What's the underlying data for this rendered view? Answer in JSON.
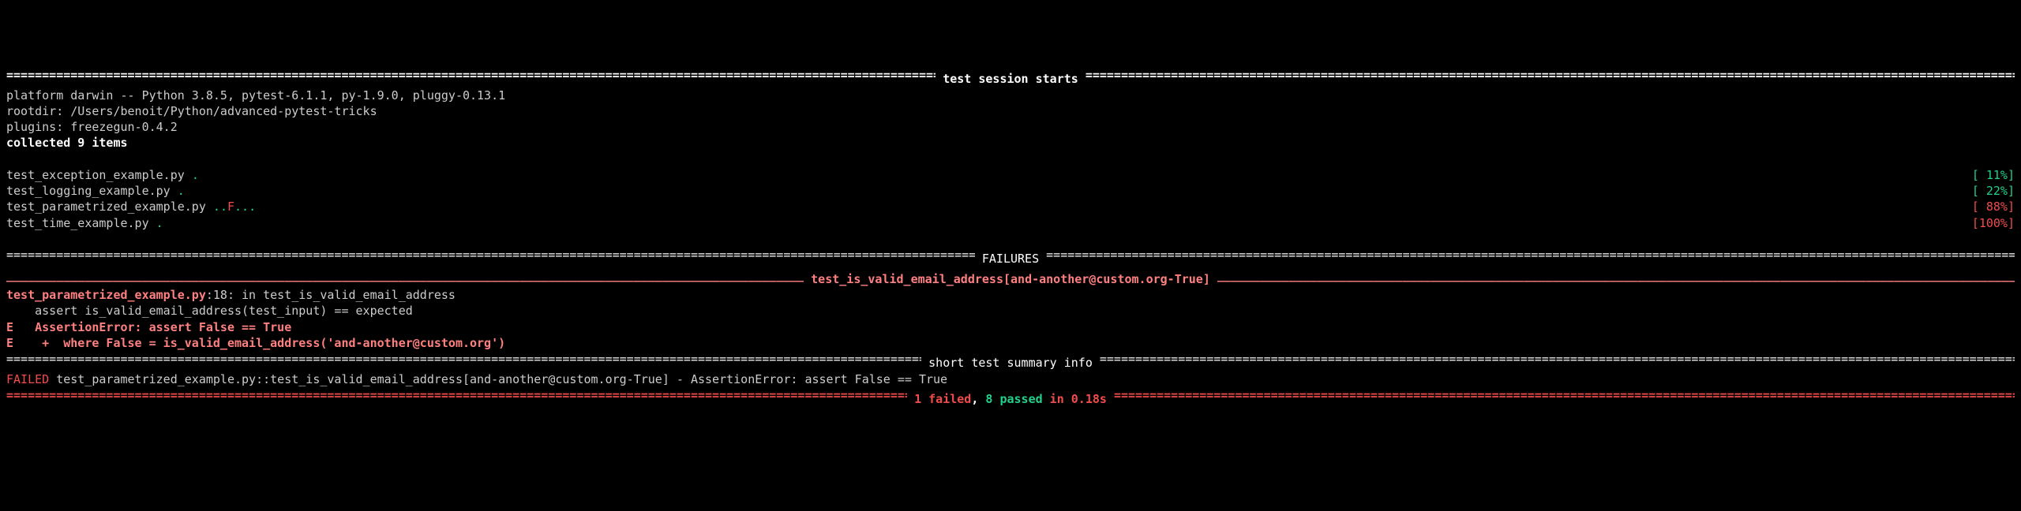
{
  "session": {
    "header_label": "test session starts",
    "platform_line": "platform darwin -- Python 3.8.5, pytest-6.1.1, py-1.9.0, pluggy-0.13.1",
    "rootdir_line": "rootdir: /Users/benoit/Python/advanced-pytest-tricks",
    "plugins_line": "plugins: freezegun-0.4.2",
    "collected_line": "collected 9 items"
  },
  "files": [
    {
      "name": "test_exception_example.py ",
      "dots": [
        {
          "c": ".",
          "k": "green"
        }
      ],
      "pct": "[ 11%]",
      "pct_k": "green"
    },
    {
      "name": "test_logging_example.py ",
      "dots": [
        {
          "c": ".",
          "k": "green"
        }
      ],
      "pct": "[ 22%]",
      "pct_k": "green"
    },
    {
      "name": "test_parametrized_example.py ",
      "dots": [
        {
          "c": ".",
          "k": "green"
        },
        {
          "c": ".",
          "k": "green"
        },
        {
          "c": "F",
          "k": "red"
        },
        {
          "c": ".",
          "k": "green"
        },
        {
          "c": ".",
          "k": "green"
        },
        {
          "c": ".",
          "k": "green"
        }
      ],
      "pct": "[ 88%]",
      "pct_k": "red"
    },
    {
      "name": "test_time_example.py ",
      "dots": [
        {
          "c": ".",
          "k": "green"
        }
      ],
      "pct": "[100%]",
      "pct_k": "red"
    }
  ],
  "failures": {
    "header_label": "FAILURES",
    "test_label": "test_is_valid_email_address[and-another@custom.org-True]",
    "trace_file": "test_parametrized_example.py",
    "trace_loc": ":18: in test_is_valid_email_address",
    "trace_code": "    assert is_valid_email_address(test_input) == expected",
    "err1": "E   AssertionError: assert False == True",
    "err2": "E    +  where False = is_valid_email_address('and-another@custom.org')"
  },
  "summary": {
    "header_label": "short test summary info",
    "failed_prefix": "FAILED",
    "failed_line": " test_parametrized_example.py::test_is_valid_email_address[and-another@custom.org-True] - AssertionError: assert False == True",
    "result_failed": "1 failed",
    "result_sep1": ", ",
    "result_passed": "8 passed",
    "result_sep2": " ",
    "result_time": "in 0.18s"
  }
}
